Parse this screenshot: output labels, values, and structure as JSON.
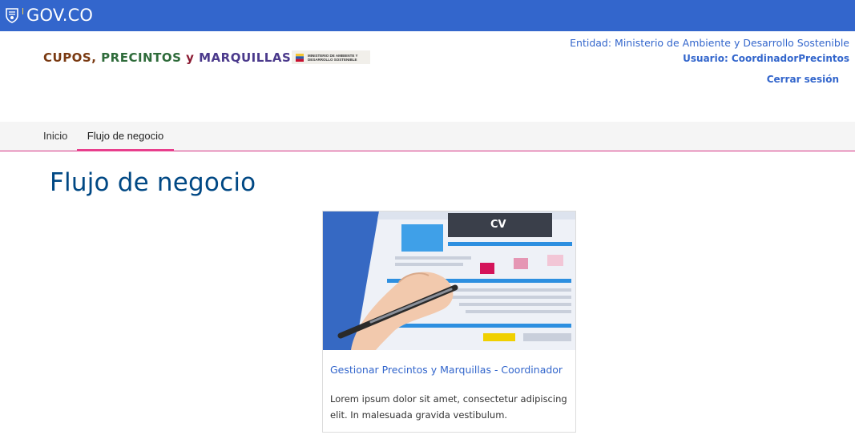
{
  "govbar": {
    "brand": "GOV.CO",
    "color": "#3366cc"
  },
  "header": {
    "logo_parts": [
      "CUPOS, ",
      "PRECINTOS ",
      "y ",
      "MARQUILLAS"
    ],
    "ministry_logo_lines": [
      "MINISTERIO DE AMBIENTE Y",
      "DESARROLLO SOSTENIBLE"
    ],
    "entity": "Entidad: Ministerio de Ambiente y Desarrollo Sostenible",
    "user": "Usuario: CoordinadorPrecintos",
    "logout": "Cerrar sesión"
  },
  "nav": {
    "tabs": [
      {
        "label": "Inicio"
      },
      {
        "label": "Flujo de negocio"
      }
    ],
    "active_tab_accent": "#e83e8c"
  },
  "main": {
    "title": "Flujo de negocio",
    "cards": [
      {
        "image_icon": "cv-document-with-pen-illustration",
        "title": "Gestionar Precintos y Marquillas - Coordinador",
        "text": "Lorem ipsum dolor sit amet, consectetur adipiscing elit. In malesuada gravida vestibulum."
      }
    ]
  },
  "colors": {
    "primary": "#3366cc",
    "title": "#004884",
    "accent": "#e83e8c"
  }
}
